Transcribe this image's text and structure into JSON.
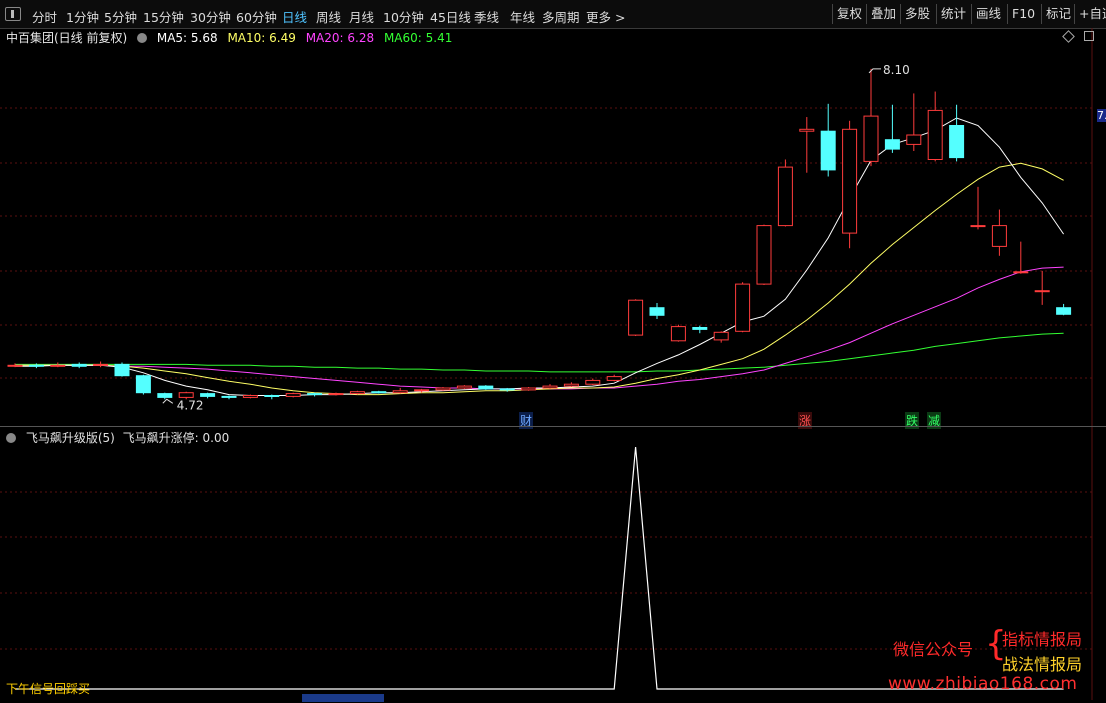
{
  "toolbar": {
    "periods": [
      "分时",
      "1分钟",
      "5分钟",
      "15分钟",
      "30分钟",
      "60分钟",
      "日线",
      "周线",
      "月线",
      "10分钟",
      "45日线",
      "季线",
      "年线",
      "多周期",
      "更多 >"
    ],
    "active_period": "日线",
    "right_buttons": [
      "复权",
      "叠加",
      "多股",
      "统计",
      "画线",
      "F10",
      "标记",
      "+自选"
    ]
  },
  "main_chart": {
    "title": "中百集团(日线 前复权)",
    "ma_labels": [
      {
        "text": "MA5: 5.68",
        "color": "#ffffff"
      },
      {
        "text": "MA10: 6.49",
        "color": "#ffff66"
      },
      {
        "text": "MA20: 6.28",
        "color": "#ff44ff"
      },
      {
        "text": "MA60: 5.41",
        "color": "#33ff33"
      }
    ],
    "high_label": "8.10",
    "low_label": "4.72",
    "right_edge_price": "7.",
    "tags": [
      {
        "text": "财",
        "color": "#6ea8ff"
      },
      {
        "text": "涨",
        "color": "#ff5050"
      },
      {
        "text": "跌",
        "color": "#33ff66"
      },
      {
        "text": "减",
        "color": "#33ff66"
      }
    ]
  },
  "sub_chart": {
    "title": "飞马飙升级版(5)",
    "value_label": "飞马飙升涨停: 0.00"
  },
  "bottom_label": "下午信号回踩买",
  "watermark": {
    "line1": "微信公众号",
    "line2": "指标情报局",
    "line3": "战法情报局",
    "url": "www.zhibiao168.com"
  },
  "chart_data": {
    "type": "candlestick",
    "series_colors": {
      "up": "#ff3c3c",
      "down": "#54ffff",
      "ma5": "#ffffff",
      "ma10": "#ffff66",
      "ma20": "#ff44ff",
      "ma60": "#33ff33"
    },
    "candles": [
      [
        4.95,
        4.96,
        4.98,
        4.94
      ],
      [
        4.96,
        4.95,
        4.98,
        4.93
      ],
      [
        4.95,
        4.96,
        4.99,
        4.94
      ],
      [
        4.97,
        4.95,
        4.99,
        4.93
      ],
      [
        4.96,
        4.97,
        5.0,
        4.94
      ],
      [
        4.97,
        4.85,
        4.99,
        4.84
      ],
      [
        4.85,
        4.67,
        4.86,
        4.65
      ],
      [
        4.66,
        4.62,
        4.67,
        4.6
      ],
      [
        4.62,
        4.67,
        4.68,
        4.6
      ],
      [
        4.66,
        4.63,
        4.67,
        4.61
      ],
      [
        4.63,
        4.62,
        4.64,
        4.6
      ],
      [
        4.62,
        4.64,
        4.65,
        4.61
      ],
      [
        4.64,
        4.63,
        4.65,
        4.6
      ],
      [
        4.63,
        4.66,
        4.67,
        4.62
      ],
      [
        4.66,
        4.65,
        4.67,
        4.63
      ],
      [
        4.65,
        4.66,
        4.67,
        4.64
      ],
      [
        4.66,
        4.68,
        4.69,
        4.65
      ],
      [
        4.68,
        4.67,
        4.69,
        4.66
      ],
      [
        4.67,
        4.69,
        4.72,
        4.66
      ],
      [
        4.69,
        4.7,
        4.71,
        4.67
      ],
      [
        4.7,
        4.72,
        4.73,
        4.69
      ],
      [
        4.72,
        4.74,
        4.75,
        4.71
      ],
      [
        4.74,
        4.71,
        4.75,
        4.7
      ],
      [
        4.71,
        4.7,
        4.72,
        4.68
      ],
      [
        4.7,
        4.72,
        4.73,
        4.69
      ],
      [
        4.72,
        4.74,
        4.76,
        4.71
      ],
      [
        4.74,
        4.76,
        4.78,
        4.73
      ],
      [
        4.76,
        4.8,
        4.82,
        4.75
      ],
      [
        4.8,
        4.84,
        4.86,
        4.79
      ],
      [
        5.28,
        5.65,
        5.66,
        5.27
      ],
      [
        5.57,
        5.49,
        5.62,
        5.45
      ],
      [
        5.22,
        5.37,
        5.39,
        5.21
      ],
      [
        5.36,
        5.34,
        5.38,
        5.3
      ],
      [
        5.23,
        5.31,
        5.32,
        5.2
      ],
      [
        5.32,
        5.82,
        5.84,
        5.31
      ],
      [
        5.82,
        6.44,
        6.45,
        5.81
      ],
      [
        6.44,
        7.06,
        7.14,
        6.43
      ],
      [
        7.44,
        7.46,
        7.59,
        7.0
      ],
      [
        7.44,
        7.03,
        7.73,
        6.96
      ],
      [
        6.36,
        7.46,
        7.55,
        6.2
      ],
      [
        7.12,
        7.6,
        8.1,
        7.07
      ],
      [
        7.35,
        7.25,
        7.72,
        7.21
      ],
      [
        7.3,
        7.4,
        7.84,
        7.23
      ],
      [
        7.14,
        7.66,
        7.86,
        7.12
      ],
      [
        7.5,
        7.16,
        7.72,
        7.12
      ],
      [
        6.44,
        6.44,
        6.85,
        6.4
      ],
      [
        6.22,
        6.44,
        6.61,
        6.12
      ],
      [
        5.94,
        5.95,
        6.27,
        5.93
      ],
      [
        5.75,
        5.75,
        5.96,
        5.6
      ],
      [
        5.57,
        5.5,
        5.61,
        5.49
      ]
    ],
    "ma5": [
      4.95,
      4.95,
      4.96,
      4.96,
      4.96,
      4.94,
      4.88,
      4.8,
      4.74,
      4.7,
      4.65,
      4.64,
      4.64,
      4.64,
      4.65,
      4.65,
      4.66,
      4.67,
      4.67,
      4.68,
      4.69,
      4.7,
      4.71,
      4.71,
      4.72,
      4.72,
      4.73,
      4.74,
      4.77,
      4.88,
      4.98,
      5.07,
      5.18,
      5.3,
      5.42,
      5.48,
      5.66,
      5.97,
      6.31,
      6.73,
      7.13,
      7.3,
      7.37,
      7.45,
      7.58,
      7.5,
      7.27,
      6.95,
      6.68,
      6.35
    ],
    "ma10": [
      4.96,
      4.96,
      4.96,
      4.96,
      4.96,
      4.95,
      4.93,
      4.9,
      4.87,
      4.83,
      4.79,
      4.76,
      4.72,
      4.69,
      4.67,
      4.66,
      4.65,
      4.65,
      4.66,
      4.67,
      4.67,
      4.68,
      4.69,
      4.69,
      4.7,
      4.71,
      4.72,
      4.72,
      4.73,
      4.77,
      4.82,
      4.86,
      4.91,
      4.97,
      5.03,
      5.13,
      5.28,
      5.44,
      5.62,
      5.82,
      6.04,
      6.24,
      6.42,
      6.6,
      6.77,
      6.93,
      7.06,
      7.1,
      7.04,
      6.92
    ],
    "ma20": [
      4.96,
      4.96,
      4.96,
      4.96,
      4.96,
      4.95,
      4.95,
      4.94,
      4.93,
      4.92,
      4.9,
      4.88,
      4.86,
      4.84,
      4.82,
      4.8,
      4.78,
      4.76,
      4.74,
      4.73,
      4.72,
      4.72,
      4.71,
      4.71,
      4.71,
      4.71,
      4.71,
      4.72,
      4.72,
      4.74,
      4.76,
      4.79,
      4.81,
      4.84,
      4.87,
      4.91,
      4.98,
      5.05,
      5.12,
      5.2,
      5.3,
      5.4,
      5.49,
      5.58,
      5.67,
      5.78,
      5.87,
      5.95,
      5.99,
      6.0
    ],
    "ma60": [
      4.97,
      4.97,
      4.97,
      4.97,
      4.97,
      4.97,
      4.97,
      4.97,
      4.97,
      4.96,
      4.96,
      4.96,
      4.95,
      4.95,
      4.94,
      4.94,
      4.93,
      4.93,
      4.92,
      4.92,
      4.91,
      4.91,
      4.9,
      4.9,
      4.9,
      4.89,
      4.89,
      4.89,
      4.89,
      4.89,
      4.9,
      4.9,
      4.91,
      4.92,
      4.93,
      4.94,
      4.96,
      4.98,
      5.0,
      5.03,
      5.06,
      5.09,
      5.12,
      5.16,
      5.19,
      5.22,
      5.25,
      5.27,
      5.29,
      5.3
    ],
    "indicator": [
      0,
      0,
      0,
      0,
      0,
      0,
      0,
      0,
      0,
      0,
      0,
      0,
      0,
      0,
      0,
      0,
      0,
      0,
      0,
      0,
      0,
      0,
      0,
      0,
      0,
      0,
      0,
      0,
      0,
      1,
      0,
      0,
      0,
      0,
      0,
      0,
      0,
      0,
      0,
      0,
      0,
      0,
      0,
      0,
      0,
      0,
      0,
      0,
      0,
      0
    ],
    "ylim": [
      4.55,
      8.3
    ],
    "indicator_ylim": [
      0,
      1
    ]
  }
}
